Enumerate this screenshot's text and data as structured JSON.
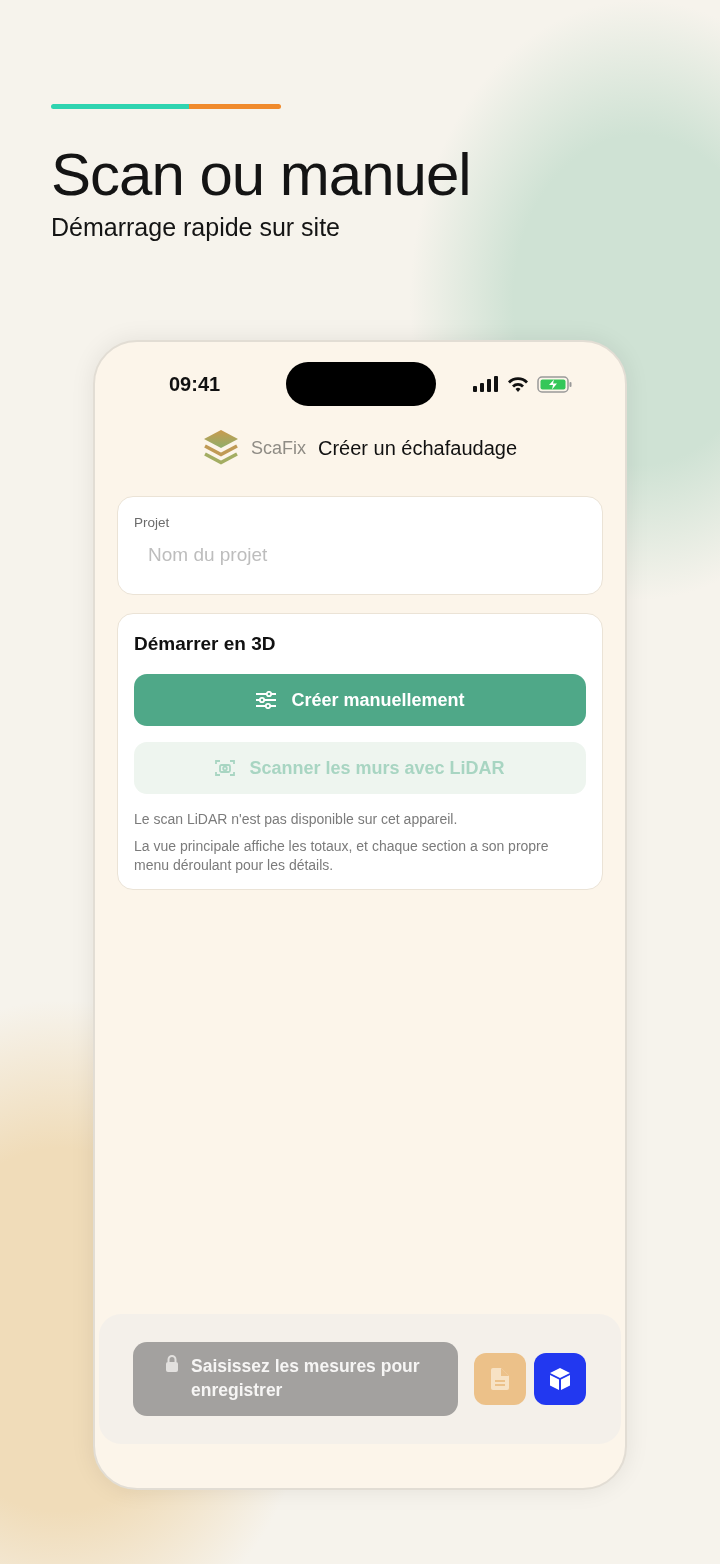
{
  "headline": {
    "title": "Scan ou manuel",
    "subtitle": "Démarrage rapide sur site"
  },
  "status_bar": {
    "time": "09:41"
  },
  "header": {
    "brand": "ScaFix",
    "title": "Créer un échafaudage"
  },
  "project_card": {
    "label": "Projet",
    "placeholder": "Nom du projet"
  },
  "start_card": {
    "title": "Démarrer en 3D",
    "buttons": [
      {
        "label": "Créer manuellement",
        "kind": "manual",
        "disabled": false
      },
      {
        "label": "Scanner les murs avec LiDAR",
        "kind": "scan",
        "disabled": true
      }
    ],
    "notes": [
      "Le scan LiDAR n'est pas disponible sur cet appareil.",
      "La vue principale affiche les totaux, et chaque section a son propre menu déroulant pour les détails."
    ]
  },
  "bottom_bar": {
    "save_button": {
      "label": "Saisissez les mesures pour enregistrer",
      "disabled": true
    },
    "icon_buttons": [
      {
        "kind": "document",
        "disabled": true
      },
      {
        "kind": "cube",
        "disabled": false
      }
    ]
  }
}
